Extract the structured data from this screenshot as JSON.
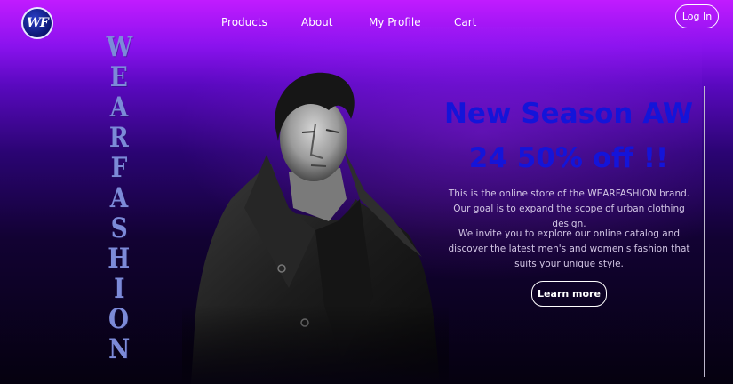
{
  "header": {
    "logo_text": "WF",
    "nav": [
      "Products",
      "About",
      "My Profile",
      "Cart"
    ],
    "login_label": "Log In"
  },
  "brand_vertical": {
    "letters": [
      "W",
      "E",
      "A",
      "R",
      "F",
      "A",
      "S",
      "H",
      "I",
      "O",
      "N"
    ]
  },
  "hero": {
    "headline_line1": "New Season AW",
    "headline_line2": "24 50% off !!",
    "paragraph1": "This is the online store of the WEARFASHION brand. Our goal is to expand the scope of urban clothing design.",
    "paragraph2": "We invite you to explore our online catalog and discover the latest men's and women's fashion that suits your unique style.",
    "cta_label": "Learn more"
  },
  "colors": {
    "headline": "#1414d9",
    "brand_vertical": "#7c8ad8",
    "background_top": "#c11bff",
    "background_bottom": "#05010f"
  }
}
